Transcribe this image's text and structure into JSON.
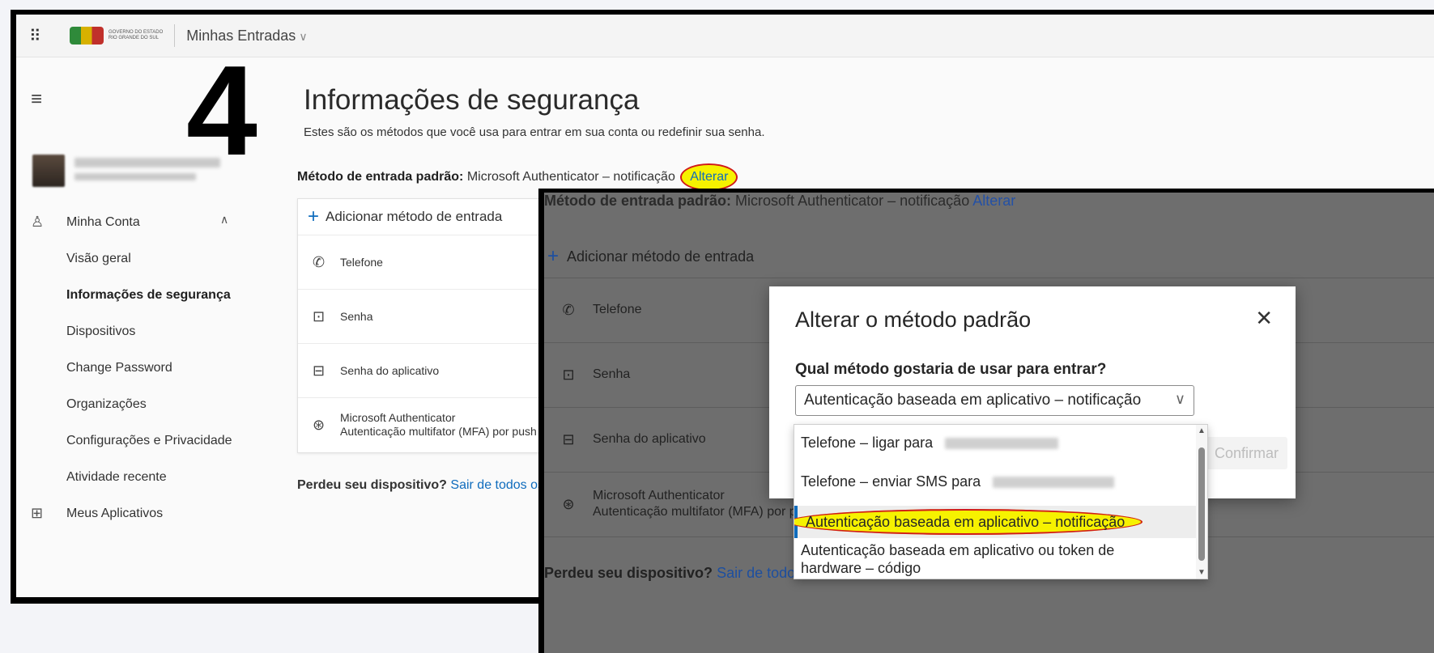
{
  "step_number": "4",
  "topbar": {
    "app_title": "Minhas Entradas",
    "gov_line1": "GOVERNO DO ESTADO",
    "gov_line2": "RIO GRANDE DO SUL"
  },
  "sidebar": {
    "items": [
      {
        "label": "Minha Conta"
      },
      {
        "label": "Visão geral"
      },
      {
        "label": "Informações de segurança"
      },
      {
        "label": "Dispositivos"
      },
      {
        "label": "Change Password"
      },
      {
        "label": "Organizações"
      },
      {
        "label": "Configurações e Privacidade"
      },
      {
        "label": "Atividade recente"
      },
      {
        "label": "Meus Aplicativos"
      }
    ]
  },
  "main": {
    "title": "Informações de segurança",
    "subtitle": "Estes são os métodos que você usa para entrar em sua conta ou redefinir sua senha.",
    "default_label": "Método de entrada padrão:",
    "default_value": "Microsoft Authenticator – notificação",
    "change_link": "Alterar",
    "add_method": "Adicionar método de entrada",
    "methods": [
      {
        "name": "Telefone"
      },
      {
        "name": "Senha"
      },
      {
        "name": "Senha do aplicativo"
      },
      {
        "name": "Microsoft Authenticator",
        "detail": "Autenticação multifator (MFA) por push"
      }
    ],
    "lost_device": "Perdeu seu dispositivo?",
    "sign_out_all": "Sair de todos os locais"
  },
  "overlay": {
    "top_label": "Método de entrada padrão:",
    "top_value": "Microsoft Authenticator – notificação",
    "top_link": "Alterar",
    "add_method": "Adicionar método de entrada",
    "lost_device": "Perdeu seu dispositivo?",
    "sign_out_all": "Sair de todos os locais",
    "dialog": {
      "title": "Alterar o método padrão",
      "question": "Qual método gostaria de usar para entrar?",
      "selected_value": "Autenticação baseada em aplicativo – notificação",
      "confirm_label": "Confirmar",
      "options": [
        "Telefone – ligar para",
        "Telefone – enviar SMS para",
        "Autenticação baseada em aplicativo – notificação",
        "Autenticação baseada em aplicativo ou token de",
        "hardware – código"
      ]
    }
  },
  "colors": {
    "link": "#0f6cbd",
    "highlight": "#f6f200",
    "annotation_red": "#d01a1a"
  }
}
